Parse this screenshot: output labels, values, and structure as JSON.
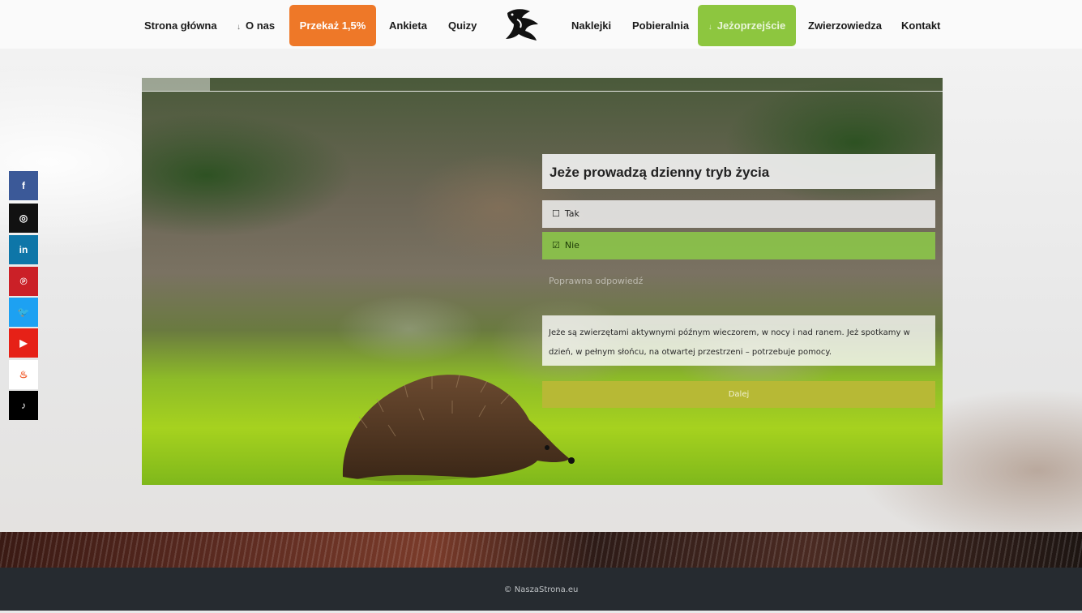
{
  "nav": {
    "items": [
      {
        "label": "Strona główna"
      },
      {
        "label": "O nas",
        "arrow": "↓"
      },
      {
        "label": "Przekaż 1,5%"
      },
      {
        "label": "Ankieta"
      },
      {
        "label": "Quizy"
      },
      {
        "label": "Naklejki"
      },
      {
        "label": "Pobieralnia"
      },
      {
        "label": "Jeżoprzejście",
        "arrow": "↓"
      },
      {
        "label": "Zwierzowiedza"
      },
      {
        "label": "Kontakt"
      }
    ],
    "accent_orange": "#ee7828",
    "accent_green": "#8dc63f"
  },
  "quiz": {
    "progress": 0.085,
    "question": "Jeże prowadzą dzienny tryb życia",
    "answers": [
      {
        "label": "Tak",
        "checked": false,
        "icon": "☐"
      },
      {
        "label": "Nie",
        "checked": true,
        "icon": "☑"
      }
    ],
    "correct_label": "Poprawna odpowiedź",
    "explanation": "Jeże są zwierzętami aktywnymi późnym wieczorem, w nocy i nad ranem. Jeż spotkamy w dzień, w pełnym słońcu, na otwartej przestrzeni – potrzebuje pomocy.",
    "next_label": "Dalej"
  },
  "social": [
    {
      "name": "facebook-icon",
      "glyph": "f",
      "color": "#3b5998"
    },
    {
      "name": "instagram-icon",
      "glyph": "◎",
      "color": "#111111"
    },
    {
      "name": "linkedin-icon",
      "glyph": "in",
      "color": "#0e76a8"
    },
    {
      "name": "pinterest-icon",
      "glyph": "℗",
      "color": "#cb2027"
    },
    {
      "name": "twitter-icon",
      "glyph": "🐦",
      "color": "#1da1f2"
    },
    {
      "name": "youtube-icon",
      "glyph": "▶",
      "color": "#e62117"
    },
    {
      "name": "tinder-icon",
      "glyph": "♨",
      "color": "#ffffff"
    },
    {
      "name": "tiktok-icon",
      "glyph": "♪",
      "color": "#000000"
    }
  ],
  "footer": {
    "text": "© NaszaStrona.eu"
  }
}
